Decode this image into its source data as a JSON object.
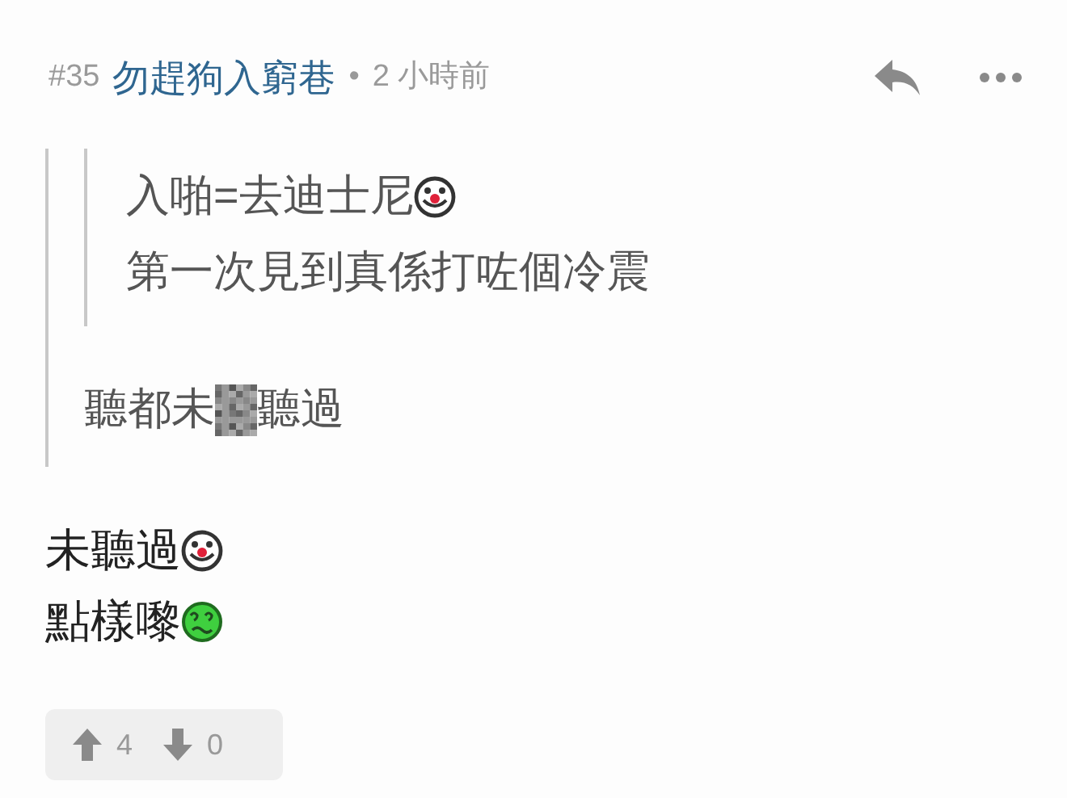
{
  "post": {
    "number": "#35",
    "author": "勿趕狗入窮巷",
    "separator": "•",
    "time": "2 小時前"
  },
  "quote": {
    "inner": [
      [
        {
          "kind": "text",
          "text": "入啪=去迪士尼"
        },
        {
          "kind": "clown"
        }
      ],
      [
        {
          "kind": "text",
          "text": "第一次見到真係打咗個冷震"
        }
      ]
    ],
    "outer": [
      [
        {
          "kind": "text",
          "text": "聽都未"
        },
        {
          "kind": "mosaic"
        },
        {
          "kind": "text",
          "text": "聽過"
        }
      ]
    ]
  },
  "body": [
    [
      {
        "kind": "text",
        "text": "未聽過"
      },
      {
        "kind": "clown"
      }
    ],
    [
      {
        "kind": "text",
        "text": "點樣嚟"
      },
      {
        "kind": "confused"
      }
    ]
  ],
  "votes": {
    "up": "4",
    "down": "0"
  }
}
